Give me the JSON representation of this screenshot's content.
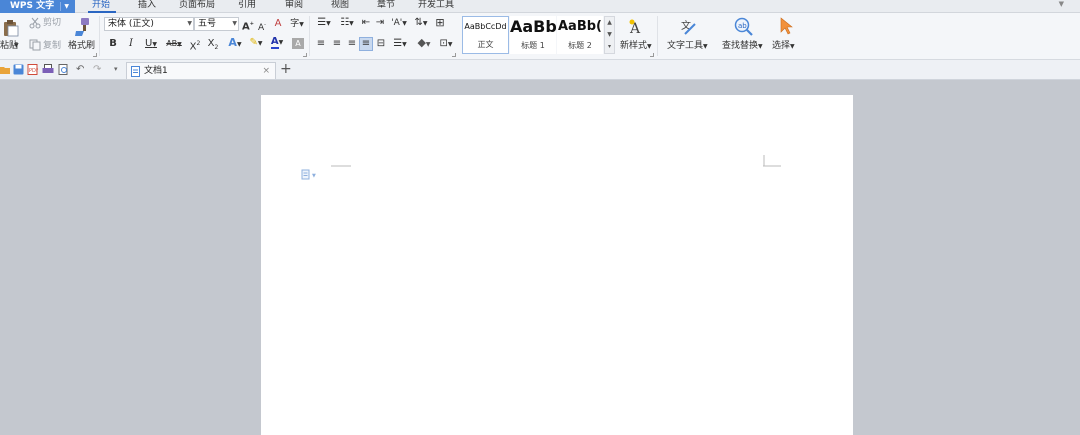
{
  "app": {
    "name": "WPS 文字"
  },
  "menu": {
    "tabs": [
      "开始",
      "插入",
      "页面布局",
      "引用",
      "审阅",
      "视图",
      "章节",
      "开发工具"
    ],
    "active": "开始"
  },
  "ribbon": {
    "clipboard": {
      "paste": "粘贴",
      "cut": "剪切",
      "copy": "复制",
      "format_painter": "格式刷"
    },
    "font": {
      "name": "宋体 (正文)",
      "size": "五号"
    },
    "styles": [
      {
        "preview": "AaBbCcDd",
        "name": "正文"
      },
      {
        "preview": "AaBb",
        "name": "标题 1"
      },
      {
        "preview": "AaBb(",
        "name": "标题 2"
      }
    ],
    "new_style": "新样式",
    "text_tools": "文字工具",
    "find_replace": "查找替换",
    "select": "选择"
  },
  "tabs": {
    "document": "文档1"
  },
  "colors": {
    "accent": "#2a66c2",
    "app_button": "#4a86d7",
    "workspace": "#c4c8cf"
  }
}
